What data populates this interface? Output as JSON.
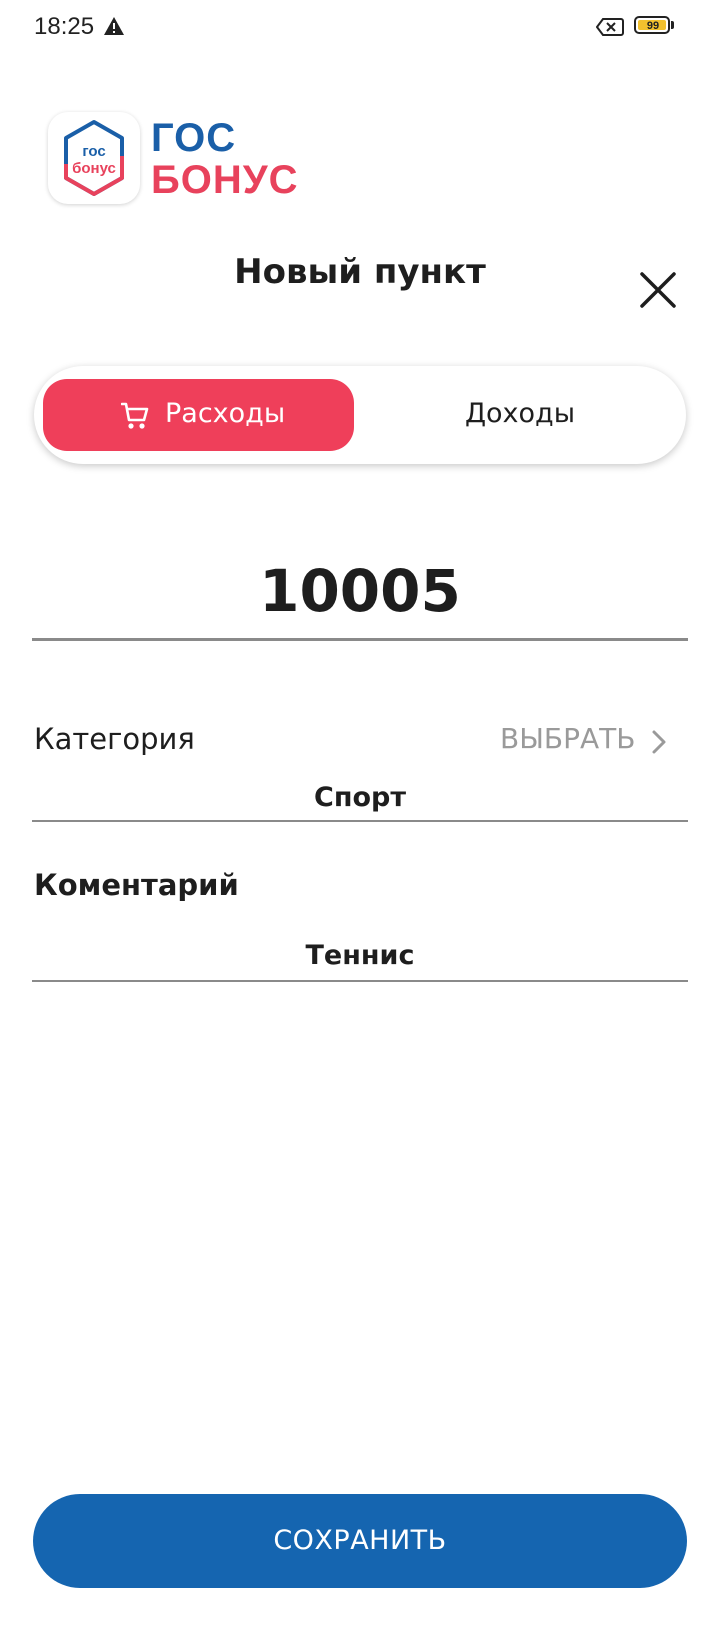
{
  "status_bar": {
    "time": "18:25",
    "battery_level": "99",
    "icons": [
      "warning-icon",
      "no-sim-icon",
      "battery-icon"
    ]
  },
  "logo": {
    "icon_text_top": "гос",
    "icon_text_bottom": "бонус",
    "word_top": "ГОС",
    "word_bottom": "БОНУС",
    "colors": {
      "blue": "#1a5fa8",
      "red": "#e8425c"
    }
  },
  "header": {
    "title": "Новый пункт",
    "close_icon": "close-icon"
  },
  "type_toggle": {
    "expenses_label": "Расходы",
    "income_label": "Доходы",
    "selected": "expenses",
    "expenses_icon": "cart-icon",
    "active_color": "#ef3f5a"
  },
  "amount": {
    "value": "10005"
  },
  "category": {
    "label": "Категория",
    "choose_label": "ВЫБРАТЬ",
    "value": "Спорт"
  },
  "comment": {
    "label": "Коментарий",
    "value": "Теннис"
  },
  "save_button": {
    "label": "СОХРАНИТЬ",
    "color": "#1565b0"
  }
}
